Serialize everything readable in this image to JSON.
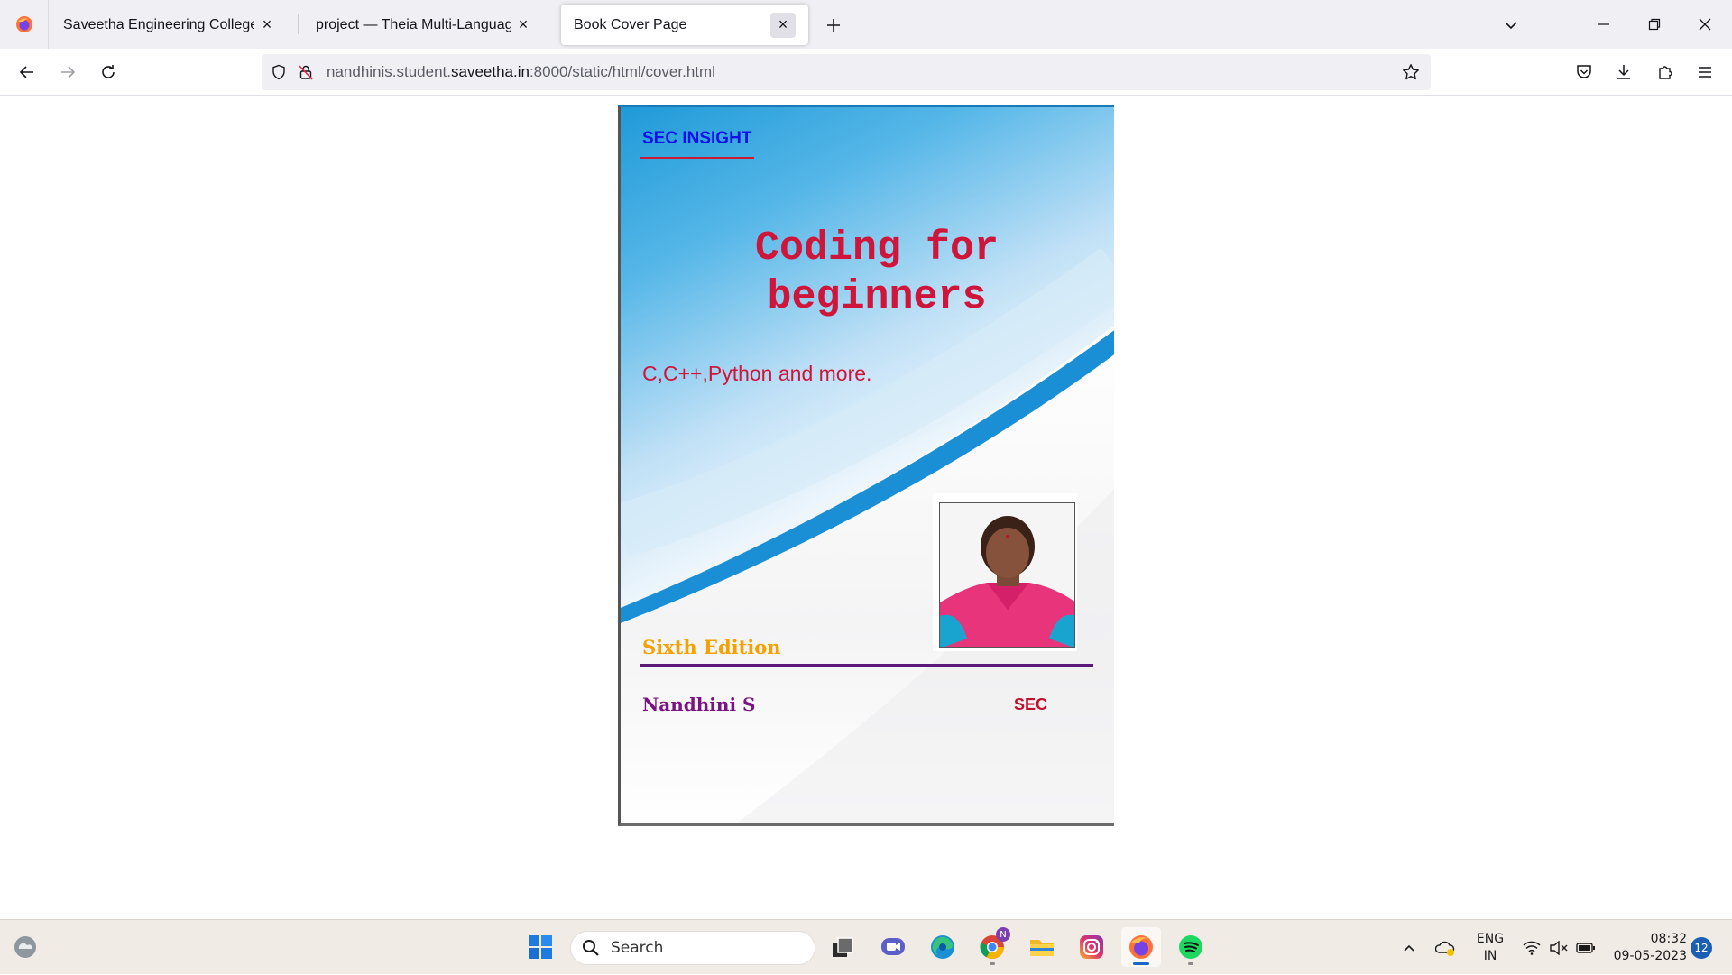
{
  "browser": {
    "tabs": [
      {
        "label": "Saveetha Engineering College",
        "active": false
      },
      {
        "label": "project — Theia Multi-Language Ex",
        "active": false
      },
      {
        "label": "Book Cover Page",
        "active": true
      }
    ],
    "url": {
      "prefix": "nandhinis.student.",
      "domain": "saveetha.in",
      "suffix": ":8000/static/html/cover.html"
    }
  },
  "cover": {
    "brand": "SEC INSIGHT",
    "title_line1": "Coding for",
    "title_line2": "beginners",
    "subtitle": "C,C++,Python and more.",
    "edition": "Sixth Edition",
    "author": "Nandhini S",
    "org": "SEC",
    "colors": {
      "title": "#d0153b",
      "brand": "#1010e8",
      "edition": "#f6a100",
      "author": "#7a1480"
    }
  },
  "taskbar": {
    "search_label": "Search",
    "chrome_badge": "N",
    "lang_line1": "ENG",
    "lang_line2": "IN",
    "time": "08:32",
    "date": "09-05-2023",
    "notifications": "12"
  }
}
